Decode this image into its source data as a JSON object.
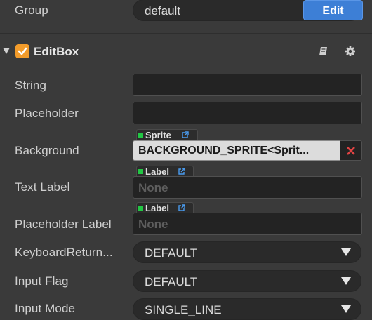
{
  "group": {
    "label": "Group",
    "value": "default",
    "edit_label": "Edit"
  },
  "component": {
    "title": "EditBox",
    "enabled": true
  },
  "properties": {
    "string": {
      "label": "String",
      "value": ""
    },
    "placeholder": {
      "label": "Placeholder",
      "value": ""
    },
    "background": {
      "label": "Background",
      "tag": "Sprite",
      "value": "BACKGROUND_SPRITE<Sprit..."
    },
    "text_label": {
      "label": "Text Label",
      "tag": "Label",
      "value": "None"
    },
    "placeholder_label": {
      "label": "Placeholder Label",
      "tag": "Label",
      "value": "None"
    },
    "keyboard_return": {
      "label": "KeyboardReturn...",
      "value": "DEFAULT"
    },
    "input_flag": {
      "label": "Input Flag",
      "value": "DEFAULT"
    },
    "input_mode": {
      "label": "Input Mode",
      "value": "SINGLE_LINE"
    }
  },
  "colors": {
    "accent": "#3d7fd6",
    "checkbox": "#f39c2b",
    "tag_dot": "#22c744",
    "clear": "#e04444"
  }
}
